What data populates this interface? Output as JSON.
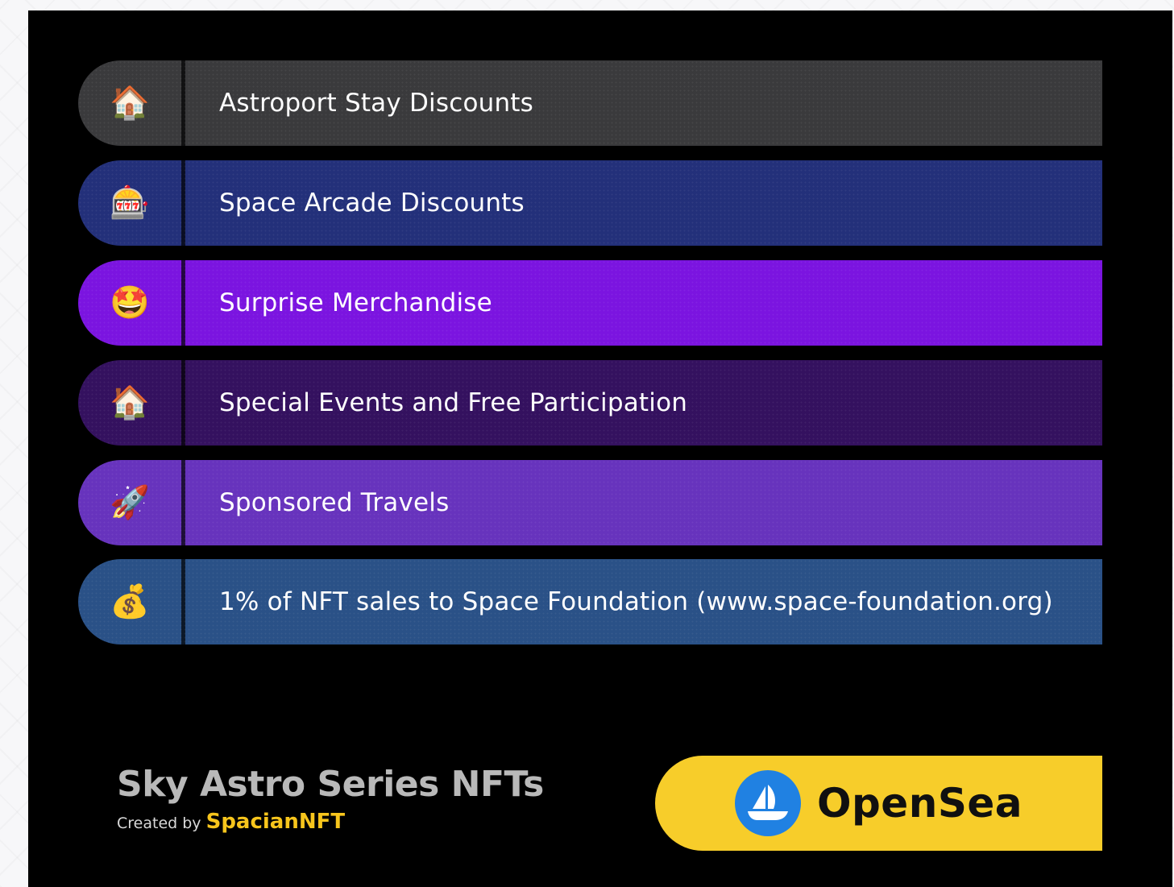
{
  "perks": [
    {
      "icon": "🏠",
      "icon_name": "house-icon",
      "label": "Astroport Stay Discounts"
    },
    {
      "icon": "🎰",
      "icon_name": "slot-machine-icon",
      "label": "Space Arcade Discounts"
    },
    {
      "icon": "🤩",
      "icon_name": "star-struck-face-icon",
      "label": "Surprise Merchandise"
    },
    {
      "icon": "🏠",
      "icon_name": "house-icon",
      "label": "Special Events and Free Participation"
    },
    {
      "icon": "🚀",
      "icon_name": "rocket-icon",
      "label": "Sponsored Travels"
    },
    {
      "icon": "💰",
      "icon_name": "money-bag-icon",
      "label": "1% of NFT sales to Space Foundation (www.space-foundation.org)"
    }
  ],
  "brand": {
    "title": "Sky Astro Series NFTs",
    "created_by": "Created by",
    "creator": "SpacianNFT"
  },
  "opensea": {
    "label": "OpenSea"
  },
  "colors": {
    "row1": "#3a3a3c",
    "row2": "#23307a",
    "row3": "#7b14e0",
    "row4": "#34115f",
    "row5": "#6733bd",
    "row6": "#2a5187",
    "accent_yellow": "#f7c51c",
    "opensea_blue": "#2081e2"
  }
}
